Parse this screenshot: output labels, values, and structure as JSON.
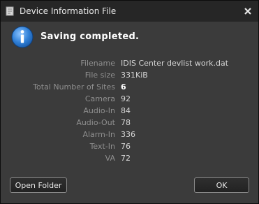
{
  "window": {
    "title": "Device Information File"
  },
  "icons": {
    "title": "document-icon",
    "close": "close-icon",
    "message": "info-icon"
  },
  "message": {
    "headline": "Saving completed."
  },
  "details": [
    {
      "label": "Filename",
      "value": "IDIS Center devlist work.dat",
      "bold": false
    },
    {
      "label": "File size",
      "value": "331KiB",
      "bold": false
    },
    {
      "label": "Total Number of Sites",
      "value": "6",
      "bold": true
    },
    {
      "label": "Camera",
      "value": "92",
      "bold": false
    },
    {
      "label": "Audio-In",
      "value": "84",
      "bold": false
    },
    {
      "label": "Audio-Out",
      "value": "78",
      "bold": false
    },
    {
      "label": "Alarm-In",
      "value": "336",
      "bold": false
    },
    {
      "label": "Text-In",
      "value": "76",
      "bold": false
    },
    {
      "label": "VA",
      "value": "72",
      "bold": false
    }
  ],
  "buttons": {
    "open_folder": "Open Folder",
    "ok": "OK"
  },
  "colors": {
    "window_bg": "#3b3b3b",
    "titlebar_bg": "#262626",
    "info_blue": "#2f7fd6"
  }
}
